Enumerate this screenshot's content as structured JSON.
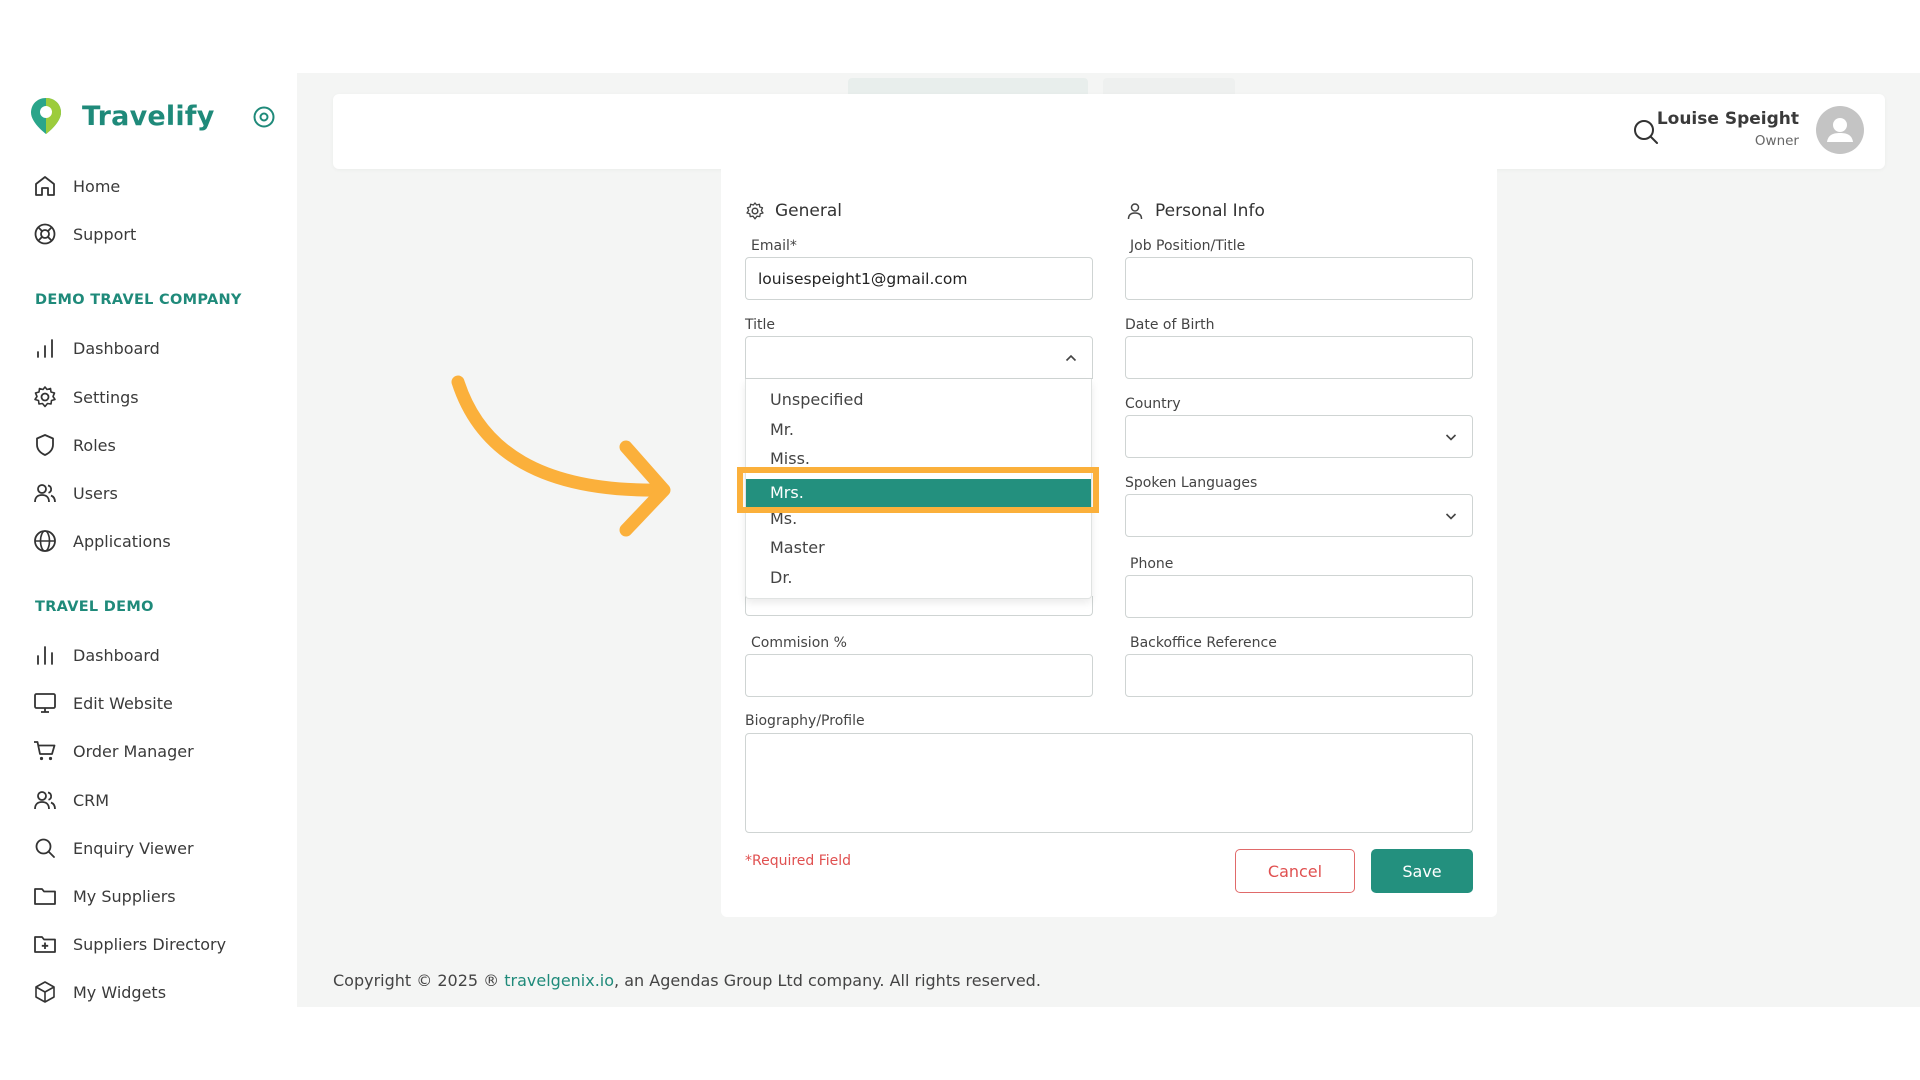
{
  "brand": {
    "name": "Travelify",
    "color": "#1f8a7a"
  },
  "nav": {
    "top": [
      {
        "label": "Home",
        "icon": "home-icon"
      },
      {
        "label": "Support",
        "icon": "lifebuoy-icon"
      }
    ],
    "section1": {
      "heading": "DEMO TRAVEL COMPANY",
      "items": [
        {
          "label": "Dashboard",
          "icon": "bar-chart-icon"
        },
        {
          "label": "Settings",
          "icon": "gear-icon"
        },
        {
          "label": "Roles",
          "icon": "shield-icon"
        },
        {
          "label": "Users",
          "icon": "users-icon"
        },
        {
          "label": "Applications",
          "icon": "globe-icon"
        }
      ]
    },
    "section2": {
      "heading": "TRAVEL DEMO",
      "items": [
        {
          "label": "Dashboard",
          "icon": "bar-chart-icon"
        },
        {
          "label": "Edit Website",
          "icon": "monitor-icon"
        },
        {
          "label": "Order Manager",
          "icon": "cart-icon"
        },
        {
          "label": "CRM",
          "icon": "users-icon"
        },
        {
          "label": "Enquiry Viewer",
          "icon": "search-icon"
        },
        {
          "label": "My Suppliers",
          "icon": "folder-icon"
        },
        {
          "label": "Suppliers Directory",
          "icon": "folder-plus-icon"
        },
        {
          "label": "My Widgets",
          "icon": "cube-icon"
        }
      ]
    }
  },
  "header": {
    "user_name": "Louise Speight",
    "user_role": "Owner"
  },
  "form": {
    "general_title": "General",
    "personal_title": "Personal Info",
    "email": {
      "label": "Email*",
      "value": "louisespeight1@gmail.com"
    },
    "title": {
      "label": "Title",
      "value": ""
    },
    "job": {
      "label": "Job Position/Title",
      "value": ""
    },
    "dob": {
      "label": "Date of Birth",
      "value": ""
    },
    "country": {
      "label": "Country",
      "value": ""
    },
    "languages": {
      "label": "Spoken Languages",
      "value": ""
    },
    "phone": {
      "label": "Phone",
      "value": ""
    },
    "commission": {
      "label": "Commision %",
      "value": ""
    },
    "backoffice": {
      "label": "Backoffice Reference",
      "value": ""
    },
    "bio": {
      "label": "Biography/Profile",
      "value": ""
    },
    "required_note": "*Required Field",
    "cancel": "Cancel",
    "save": "Save"
  },
  "title_dropdown": {
    "options": [
      "Unspecified",
      "Mr.",
      "Miss.",
      "Mrs.",
      "Ms.",
      "Master",
      "Dr."
    ],
    "selected": "Mrs."
  },
  "footer": {
    "prefix": "Copyright © 2025 ® ",
    "link": "travelgenix.io",
    "suffix": ", an Agendas Group Ltd company. All rights reserved."
  },
  "colors": {
    "accent": "#23907e",
    "highlight": "#fbb03b",
    "danger": "#e05050"
  }
}
